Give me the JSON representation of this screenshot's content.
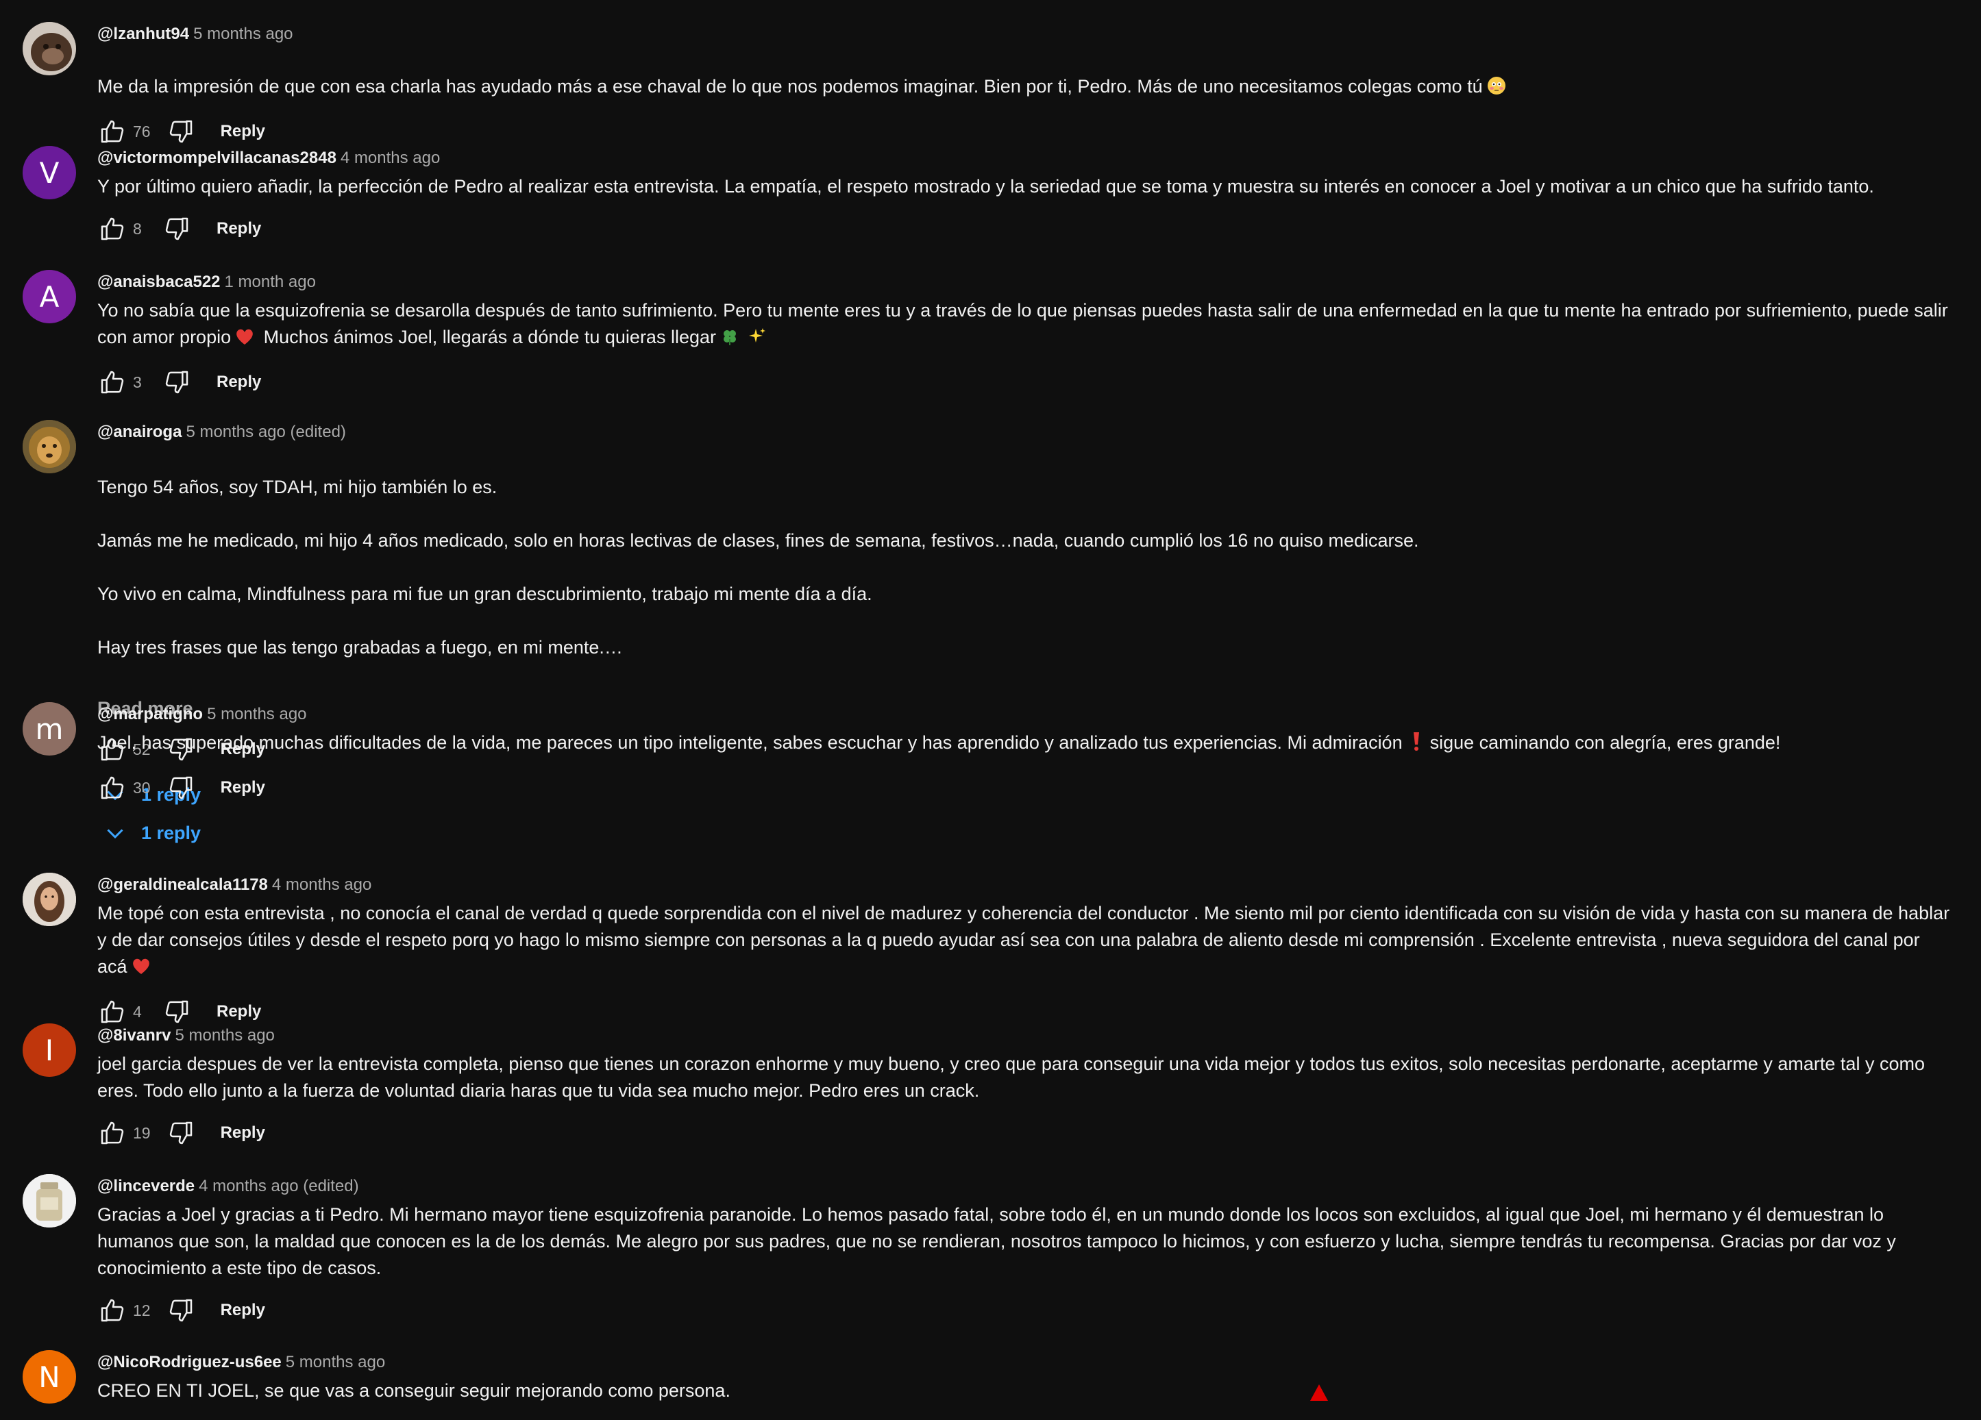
{
  "colors": {
    "background": "#0f0f0f",
    "text": "#f1f1f1",
    "secondary": "#aaaaaa",
    "link": "#3ea6ff",
    "heart": "#e53935"
  },
  "comments": [
    {
      "author": "@lzanhut94",
      "time": "5 months ago",
      "avatar": {
        "type": "photo",
        "name": "monkey-photo"
      },
      "text": "Me da la impresión de que con esa charla has ayudado más a ese chaval de lo que nos podemos imaginar. Bien por ti, Pedro. Más de uno necesitamos colegas como tú",
      "emoji": "😳",
      "likes": "76",
      "reply_label": "Reply"
    },
    {
      "author": "@victormompelvillacanas2848",
      "time": "4 months ago",
      "avatar": {
        "type": "letter",
        "letter": "V",
        "color": "#6a1b9a"
      },
      "text": "Y por último quiero añadir, la perfección de Pedro al realizar esta entrevista. La empatía, el respeto mostrado y la seriedad que se toma y muestra su interés en conocer a Joel y motivar a un chico que ha sufrido tanto.",
      "likes": "8",
      "reply_label": "Reply"
    },
    {
      "author": "@anaisbaca522",
      "time": "1 month ago",
      "avatar": {
        "type": "letter",
        "letter": "A",
        "color": "#7b1fa2"
      },
      "text": "Yo no sabía que la esquizofrenia se desarolla después de tanto sufrimiento. Pero tu mente eres tu y a través de lo que piensas puedes hasta salir de una enfermedad en la que tu mente ha entrado por sufriemiento, puede salir con amor propio",
      "text_after_heart": " Muchos ánimos Joel, llegarás a dónde tu quieras llegar",
      "likes": "3",
      "reply_label": "Reply"
    },
    {
      "author": "@anairoga",
      "time": "5 months ago (edited)",
      "avatar": {
        "type": "photo",
        "name": "lion-photo"
      },
      "lines": [
        "Tengo 54 años, soy TDAH, mi hijo también lo es.",
        "Jamás me he medicado, mi hijo 4 años medicado, solo en horas lectivas de clases, fines de semana, festivos…nada, cuando cumplió los 16 no quiso medicarse.",
        "Yo vivo en calma, Mindfulness para mi fue un gran descubrimiento, trabajo mi mente día a día.",
        "Hay tres frases que las tengo grabadas a fuego, en mi mente.…"
      ],
      "read_more": "Read more",
      "likes": "52",
      "reply_label": "Reply",
      "replies_label": "1 reply"
    },
    {
      "author": "@marpatigno",
      "time": "5 months ago",
      "avatar": {
        "type": "letter",
        "letter": "m",
        "color": "#8d6e63"
      },
      "text": "Joel, has superado muchas dificultades de la vida, me pareces un tipo inteligente, sabes escuchar y has aprendido y analizado tus experiencias. Mi admiración",
      "emoji": "❗",
      "text_after_emoji": "sigue caminando con alegría, eres grande!",
      "likes": "30",
      "reply_label": "Reply",
      "replies_label": "1 reply"
    },
    {
      "author": "@geraldinealcala1178",
      "time": "4 months ago",
      "avatar": {
        "type": "photo",
        "name": "woman-photo"
      },
      "text": "Me topé con esta entrevista , no conocía el canal de verdad q quede sorprendida con el nivel de madurez y coherencia del conductor . Me siento mil por ciento identificada con su visión de vida y hasta con su manera de hablar y de dar consejos útiles y desde el respeto porq yo hago lo mismo siempre con personas a la q puedo ayudar así sea con una palabra de aliento desde mi comprensión . Excelente entrevista , nueva seguidora del canal por acá",
      "likes": "4",
      "reply_label": "Reply"
    },
    {
      "author": "@8ivanrv",
      "time": "5 months ago",
      "avatar": {
        "type": "letter",
        "letter": "I",
        "color": "#bf360c"
      },
      "text": "joel garcia despues de ver la entrevista completa, pienso que tienes un corazon enhorme y muy bueno, y creo que para conseguir una vida mejor y todos tus exitos, solo necesitas perdonarte, aceptarme y amarte tal y como eres. Todo ello junto a la fuerza de voluntad diaria haras que tu vida sea mucho mejor. Pedro eres un crack.",
      "likes": "19",
      "reply_label": "Reply"
    },
    {
      "author": "@linceverde",
      "time": "4 months ago (edited)",
      "avatar": {
        "type": "photo",
        "name": "jar-photo"
      },
      "text": "Gracias a Joel y gracias a ti Pedro. Mi hermano mayor tiene esquizofrenia paranoide. Lo hemos pasado fatal, sobre todo él, en un mundo donde los locos son excluidos, al igual que Joel, mi hermano y él demuestran lo humanos que son, la maldad que conocen es la de los demás. Me alegro por sus padres, que no se rendieran, nosotros tampoco lo hicimos, y con esfuerzo y lucha, siempre tendrás tu recompensa. Gracias por dar voz y conocimiento a este tipo de casos.",
      "likes": "12",
      "reply_label": "Reply"
    },
    {
      "author": "@NicoRodriguez-us6ee",
      "time": "5 months ago",
      "avatar": {
        "type": "letter",
        "letter": "N",
        "color": "#ef6c00"
      },
      "text": "CREO EN TI JOEL, se que vas a conseguir seguir mejorando como persona."
    }
  ]
}
